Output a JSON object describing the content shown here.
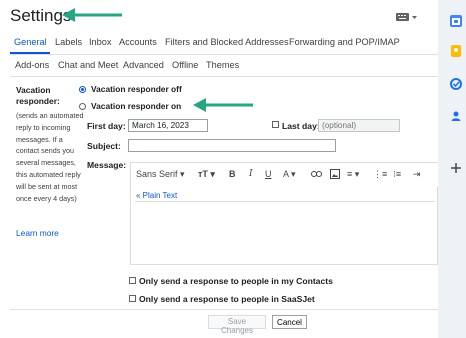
{
  "page": {
    "title": "Settings"
  },
  "tabs_row1": [
    "General",
    "Labels",
    "Inbox",
    "Accounts",
    "Filters and Blocked Addresses",
    "Forwarding and POP/IMAP"
  ],
  "tabs_row2": [
    "Add-ons",
    "Chat and Meet",
    "Advanced",
    "Offline",
    "Themes"
  ],
  "vacation": {
    "label": "Vacation responder:",
    "help": "(sends an automated reply to incoming messages. If a contact sends you several messages, this automated reply will be sent at most once every 4 days)",
    "learn_more": "Learn more",
    "off_label": "Vacation responder off",
    "on_label": "Vacation responder on",
    "selected": "off"
  },
  "first_day": {
    "label": "First day:",
    "value": "March 16, 2023"
  },
  "last_day": {
    "label": "Last day:",
    "placeholder": "(optional)"
  },
  "subject": {
    "label": "Subject:",
    "value": ""
  },
  "message": {
    "label": "Message:",
    "font": "Sans Serif",
    "plain_text_link": "« Plain Text"
  },
  "options": {
    "contacts_only": "Only send a response to people in my Contacts",
    "org_only": "Only send a response to people in SaaSJet"
  },
  "buttons": {
    "save": "Save Changes",
    "cancel": "Cancel"
  },
  "colors": {
    "accent": "#0b57d0",
    "arrow": "#26a682"
  }
}
